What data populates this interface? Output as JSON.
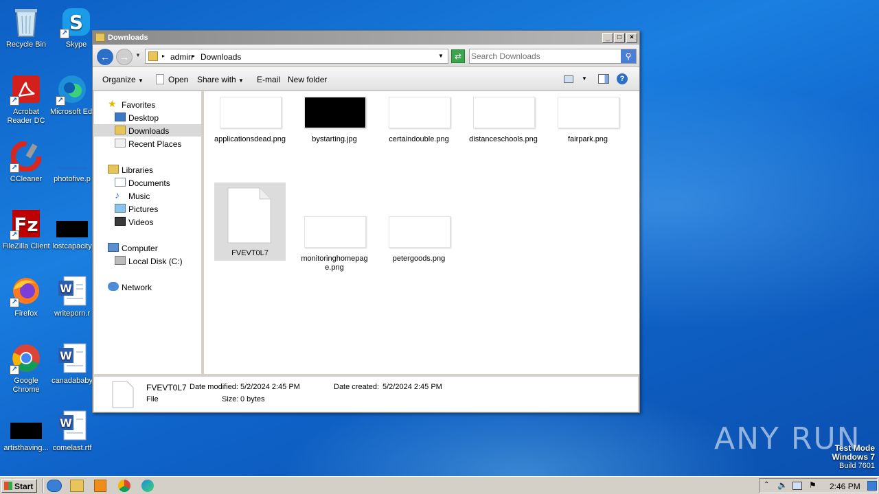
{
  "desktop": {
    "icons": [
      {
        "label": "Recycle Bin",
        "icon": "recycle-bin-icon"
      },
      {
        "label": "Skype",
        "icon": "skype-icon"
      },
      {
        "label": "Acrobat Reader DC",
        "icon": "acrobat-icon"
      },
      {
        "label": "Microsoft Edge",
        "icon": "edge-icon"
      },
      {
        "label": "CCleaner",
        "icon": "ccleaner-icon"
      },
      {
        "label": "photofive.p",
        "icon": "image-file-icon"
      },
      {
        "label": "FileZilla Client",
        "icon": "filezilla-icon"
      },
      {
        "label": "lostcapacity",
        "icon": "image-file-icon"
      },
      {
        "label": "Firefox",
        "icon": "firefox-icon"
      },
      {
        "label": "writeporn.r",
        "icon": "word-doc-icon"
      },
      {
        "label": "Google Chrome",
        "icon": "chrome-icon"
      },
      {
        "label": "canadababy",
        "icon": "word-doc-icon"
      },
      {
        "label": "artisthaving...",
        "icon": "image-file-icon"
      },
      {
        "label": "comelast.rtf",
        "icon": "word-doc-icon"
      }
    ]
  },
  "window": {
    "title": "Downloads",
    "breadcrumb": [
      "admin",
      "Downloads"
    ],
    "search_placeholder": "Search Downloads",
    "toolbar": {
      "organize": "Organize",
      "open": "Open",
      "share_with": "Share with",
      "email": "E-mail",
      "new_folder": "New folder"
    },
    "nav": {
      "favorites": "Favorites",
      "desktop": "Desktop",
      "downloads": "Downloads",
      "recent_places": "Recent Places",
      "libraries": "Libraries",
      "documents": "Documents",
      "music": "Music",
      "pictures": "Pictures",
      "videos": "Videos",
      "computer": "Computer",
      "local_disk": "Local Disk (C:)",
      "network": "Network"
    },
    "files": [
      {
        "name": "applicationsdead.png",
        "thumb": "white"
      },
      {
        "name": "bystarting.jpg",
        "thumb": "black"
      },
      {
        "name": "certaindouble.png",
        "thumb": "white"
      },
      {
        "name": "distanceschools.png",
        "thumb": "white"
      },
      {
        "name": "fairpark.png",
        "thumb": "white"
      },
      {
        "name": "FVEVT0L7",
        "thumb": "blank-file",
        "selected": true
      },
      {
        "name": "monitoringhomepage.png",
        "thumb": "white"
      },
      {
        "name": "petergoods.png",
        "thumb": "white"
      }
    ],
    "details": {
      "name": "FVEVT0L7",
      "type": "File",
      "modified_label": "Date modified:",
      "modified_value": "5/2/2024 2:45 PM",
      "created_label": "Date created:",
      "created_value": "5/2/2024 2:45 PM",
      "size_label": "Size:",
      "size_value": "0 bytes"
    }
  },
  "taskbar": {
    "start": "Start",
    "clock": "2:46 PM"
  },
  "watermark": {
    "brand": "ANY RUN",
    "line1": "Test Mode",
    "line2": "Windows 7",
    "line3": "Build 7601"
  }
}
